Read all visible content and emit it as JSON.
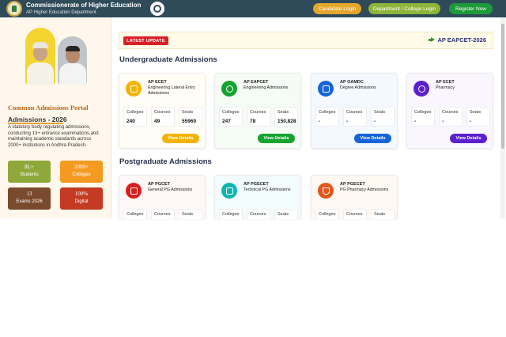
{
  "header": {
    "title": "Commissionerate of Higher Education",
    "subtitle": "AP Higher Education Department",
    "buttons": {
      "candidate": "Candidate Login",
      "department": "Department / College Login",
      "register": "Register Now"
    }
  },
  "sidebar": {
    "portal_title": "Common Admissions Portal",
    "admissions_year": "Admissions - 2026",
    "description": "A statutory body regulating admissions, conducting 13+ entrance examinations,and maintaining academic standards across 2000+ institutions in Andhra Pradesh.",
    "tiles": [
      {
        "value": "8L+",
        "label": "Students"
      },
      {
        "value": "2000+",
        "label": "Colleges"
      },
      {
        "value": "13",
        "label": "Exams 2026"
      },
      {
        "value": "100%",
        "label": "Digital"
      }
    ]
  },
  "update": {
    "tag": "LATEST UPDATE",
    "news": "AP EAPCET-2026"
  },
  "sections": {
    "ug": "Undergraduate Admissions",
    "pg": "Postgraduate Admissions"
  },
  "stat_labels": {
    "colleges": "Colleges",
    "courses": "Courses",
    "seats": "Seats"
  },
  "ug_cards": [
    {
      "name": "AP ECET",
      "desc": "Engineering Lateral Entry Admissions",
      "colleges": "240",
      "courses": "49",
      "seats": "55960",
      "button": "View Details"
    },
    {
      "name": "AP EAPCET",
      "desc": "Engineering Admissions",
      "colleges": "247",
      "courses": "78",
      "seats": "150,828",
      "button": "View Details"
    },
    {
      "name": "AP OAMDC",
      "desc": "Degree Admissions",
      "colleges": "-",
      "courses": "-",
      "seats": "-",
      "button": "View Details"
    },
    {
      "name": "AP ECET",
      "desc": "Pharmacy",
      "colleges": "-",
      "courses": "-",
      "seats": "-",
      "button": "View Details"
    }
  ],
  "pg_cards": [
    {
      "name": "AP PGCET",
      "desc": "General PG Admissions"
    },
    {
      "name": "AP PGECET",
      "desc": "Technical PG Admissions"
    },
    {
      "name": "AP PGECET",
      "desc": "PG Pharmacy Admissions"
    }
  ],
  "colors": {
    "header": "#2f4a59",
    "candidate_btn": "#e4a72b",
    "department_btn": "#8fb43a",
    "register_btn": "#1d9a3a",
    "accent_orange": "#b76516",
    "update_tag": "#d92027"
  },
  "icons": [
    "logo-icon",
    "emblem-icon",
    "megaphone-icon",
    "certificate-icon",
    "gear-icon",
    "graduation-icon",
    "pharmacy-icon",
    "book-icon",
    "tools-icon",
    "flask-icon"
  ]
}
